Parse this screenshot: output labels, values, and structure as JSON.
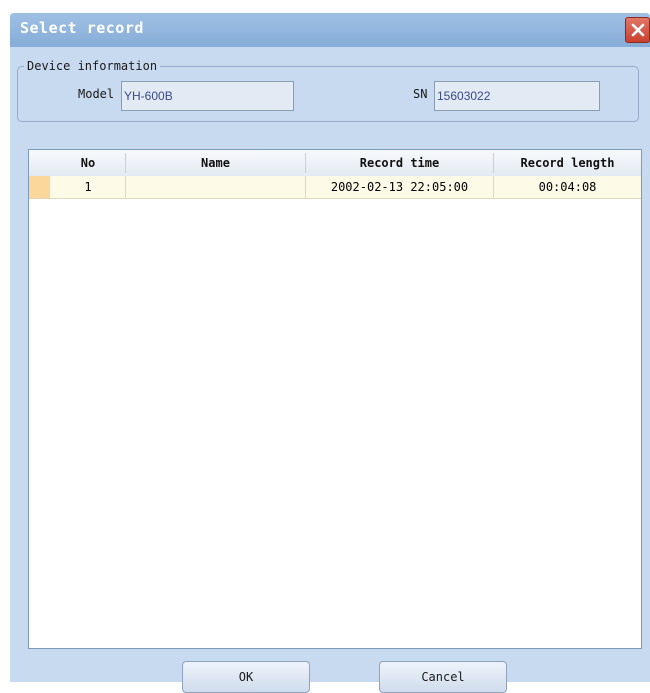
{
  "window": {
    "title": "Select record",
    "close_icon": "close-icon"
  },
  "device_info": {
    "group_label": "Device information",
    "model_label": "Model",
    "model_value": "YH-600B",
    "sn_label": "SN",
    "sn_value": "15603022"
  },
  "table": {
    "columns": [
      "No",
      "Name",
      "Record time",
      "Record length"
    ],
    "rows": [
      {
        "no": "1",
        "name": "",
        "record_time": "2002-02-13 22:05:00",
        "record_length": "00:04:08"
      }
    ]
  },
  "buttons": {
    "ok_label": "OK",
    "cancel_label": "Cancel"
  },
  "colors": {
    "title_bar": "#8fb4de",
    "close_button": "#d4503e",
    "selected_row": "#fefae8",
    "row_indicator": "#fbd79c"
  }
}
